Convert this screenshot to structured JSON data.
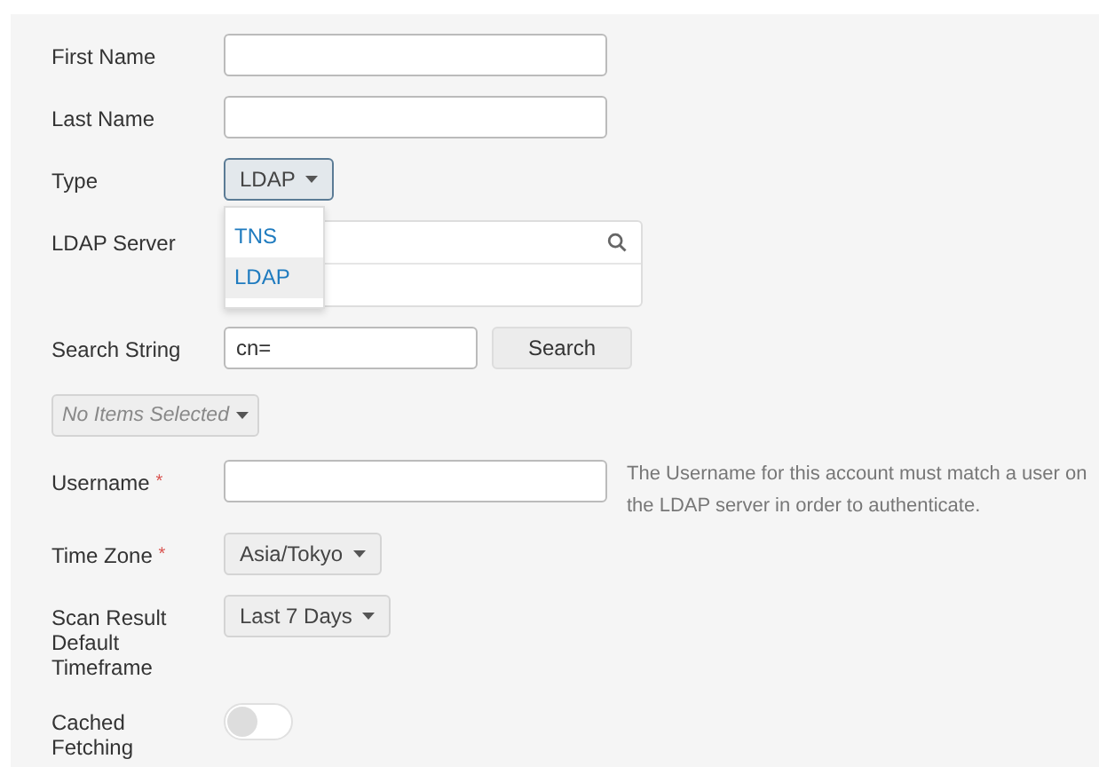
{
  "form": {
    "fields": [
      {
        "kind": "text",
        "label": "First Name"
      },
      {
        "kind": "text",
        "label": "Last Name"
      },
      {
        "kind": "select",
        "label": "Type",
        "value": "LDAP",
        "focused": true,
        "menu": [
          {
            "label": "TNS",
            "selected": false
          },
          {
            "label": "LDAP",
            "selected": true
          }
        ]
      },
      {
        "kind": "lookup",
        "label": "LDAP Server"
      },
      {
        "kind": "search",
        "label": "Search String",
        "value": "cn=",
        "button": "Search"
      },
      {
        "kind": "multiselect",
        "placeholder": "No Items Selected"
      },
      {
        "kind": "text",
        "label": "Username",
        "required_marker": "*",
        "help": "The Username for this account must match a user on the LDAP server in order to authenticate."
      },
      {
        "kind": "select",
        "label": "Time Zone",
        "required_marker": "*",
        "value": "Asia/Tokyo",
        "focused": false
      },
      {
        "kind": "select",
        "label": "Scan Result Default Timeframe",
        "value": "Last 7 Days",
        "focused": false
      },
      {
        "kind": "toggle",
        "label": "Cached Fetching",
        "on": false
      }
    ]
  }
}
